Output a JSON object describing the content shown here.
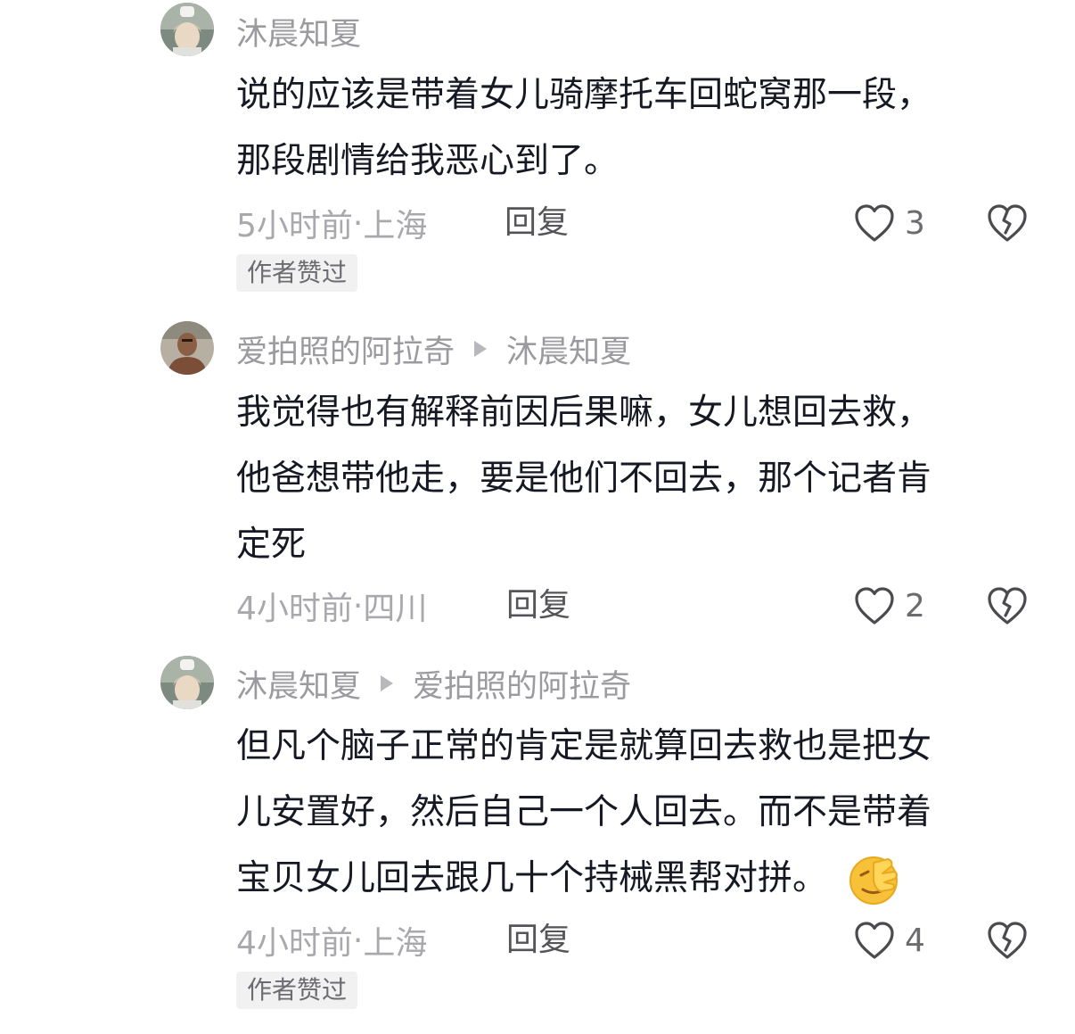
{
  "comments": [
    {
      "author": "沐晨知夏",
      "reply_to": "",
      "text_lines": [
        "说的应该是带着女儿骑摩托车回蛇窝那一段，",
        "那段剧情给我恶心到了。"
      ],
      "time": "5小时前",
      "location": "上海",
      "reply_label": "回复",
      "likes": "3",
      "badge": "作者赞过"
    },
    {
      "author": "爱拍照的阿拉奇",
      "reply_to": "沐晨知夏",
      "text_lines": [
        "我觉得也有解释前因后果嘛，女儿想回去救，",
        "他爸想带他走，要是他们不回去，那个记者肯",
        "定死"
      ],
      "time": "4小时前",
      "location": "四川",
      "reply_label": "回复",
      "likes": "2",
      "badge": ""
    },
    {
      "author": "沐晨知夏",
      "reply_to": "爱拍照的阿拉奇",
      "text_lines": [
        "但凡个脑子正常的肯定是就算回去救也是把女",
        "儿安置好，然后自己一个人回去。而不是带着",
        "宝贝女儿回去跟几十个持械黑帮对拼。"
      ],
      "emoji": "face-palm-emoji",
      "time": "4小时前",
      "location": "上海",
      "reply_label": "回复",
      "likes": "4",
      "badge": "作者赞过"
    }
  ],
  "separator": " · ",
  "icons": {
    "like": "heart-outline-icon",
    "dislike": "broken-heart-icon"
  },
  "colors": {
    "text": "#161823",
    "meta": "#a8a8ad",
    "badge_bg": "#f1f1f2"
  }
}
